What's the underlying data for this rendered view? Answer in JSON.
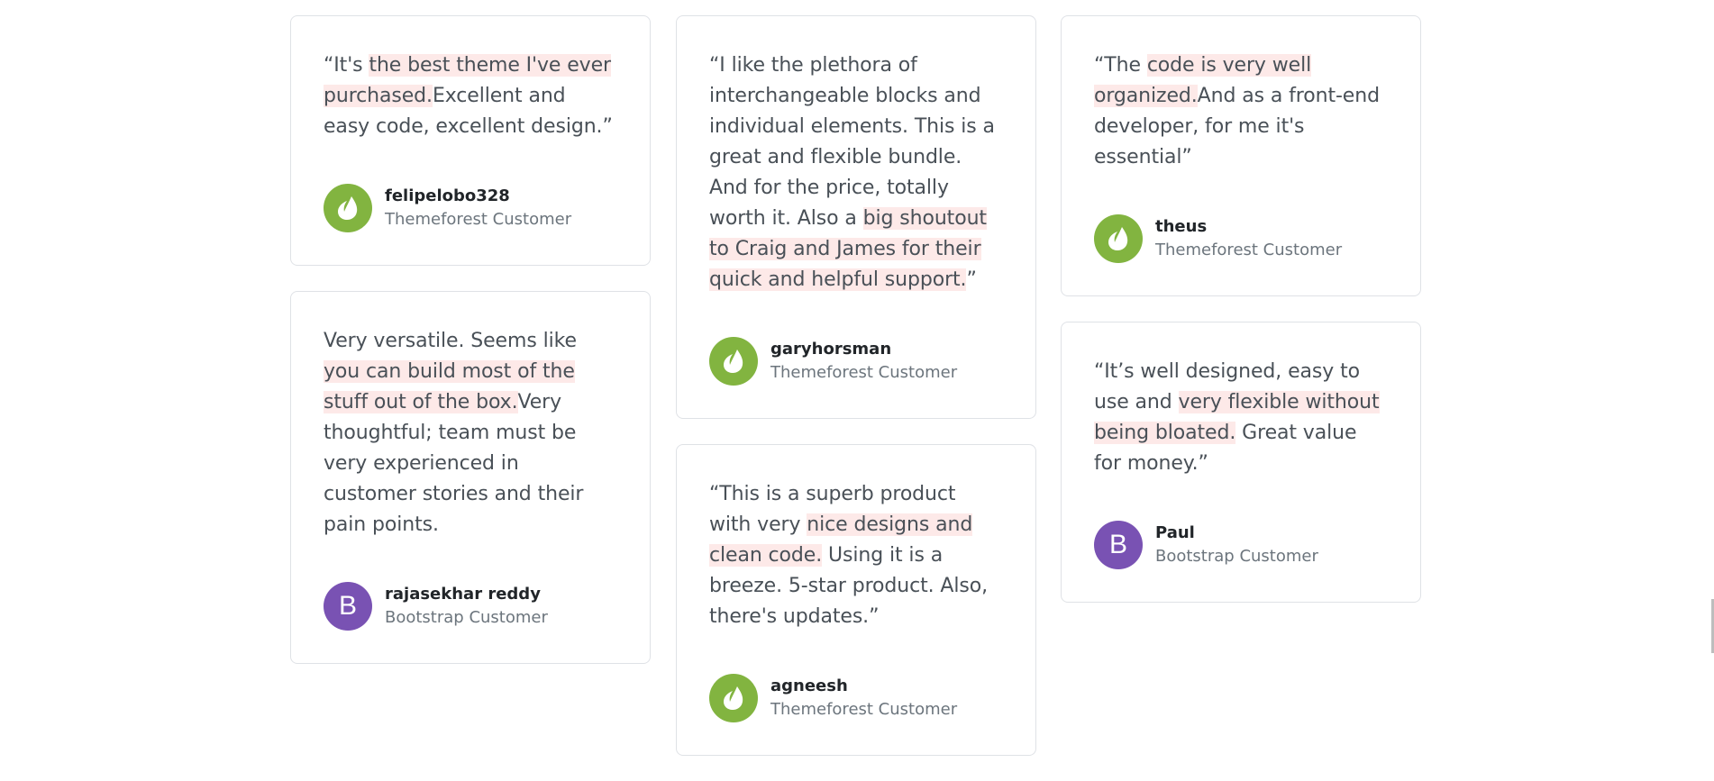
{
  "colors": {
    "highlight": "#fde9e8",
    "envato_green": "#82b440",
    "bootstrap_purple": "#7952b3",
    "card_border": "#dfe2e6"
  },
  "testimonials": [
    {
      "quote_parts": [
        "“It's ",
        "the best theme I've ever purchased.",
        "Excellent and easy code, excellent design.”"
      ],
      "name": "felipelobo328",
      "role": "Themeforest Customer",
      "avatar": "envato-leaf-icon"
    },
    {
      "quote_parts": [
        "Very versatile. Seems like ",
        "you can build most of the stuff out of the box.",
        "Very thoughtful; team must be very experienced in customer stories and their pain points."
      ],
      "name": "rajasekhar reddy",
      "role": "Bootstrap Customer",
      "avatar": "bootstrap-b-icon",
      "avatar_letter": "B"
    },
    {
      "quote_parts": [
        "“I like the plethora of interchangeable blocks and individual elements. This is a great and flexible bundle. And for the price, totally worth it. Also a ",
        "big shoutout to Craig and James for their quick and helpful support.",
        "”"
      ],
      "name": "garyhorsman",
      "role": "Themeforest Customer",
      "avatar": "envato-leaf-icon"
    },
    {
      "quote_parts": [
        "“This is a superb product with very ",
        "nice designs and clean code.",
        " Using it is a breeze. 5-star product. Also, there's updates.”"
      ],
      "name": "agneesh",
      "role": "Themeforest Customer",
      "avatar": "envato-leaf-icon"
    },
    {
      "quote_parts": [
        "“The ",
        "code is very well organized.",
        "And as a front-end developer, for me it's essential”"
      ],
      "name": "theus",
      "role": "Themeforest Customer",
      "avatar": "envato-leaf-icon"
    },
    {
      "quote_parts": [
        "“It’s well designed, easy to use and ",
        "very flexible without being bloated.",
        " Great value for money.”"
      ],
      "name": "Paul",
      "role": "Bootstrap Customer",
      "avatar": "bootstrap-b-icon",
      "avatar_letter": "B"
    }
  ]
}
